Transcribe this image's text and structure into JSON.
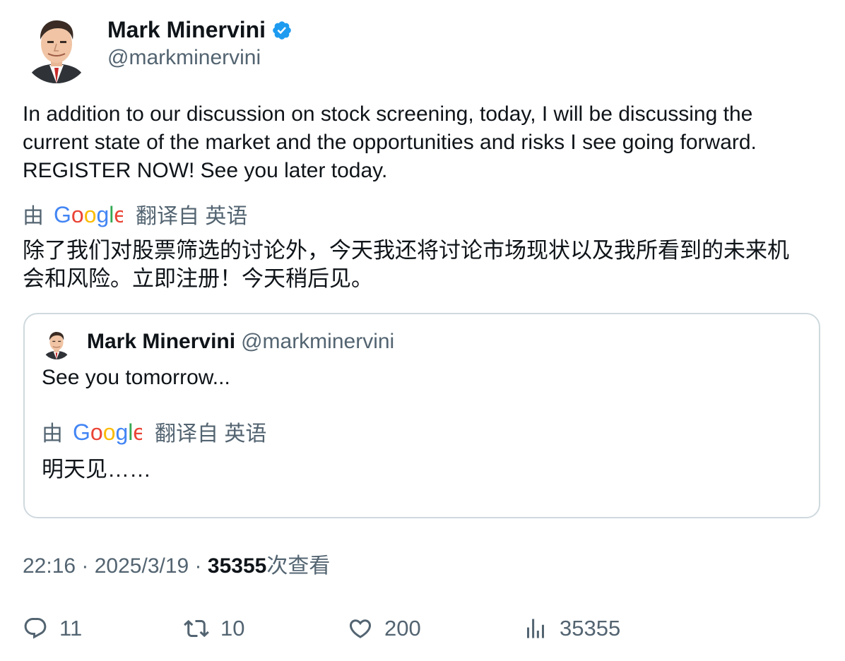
{
  "tweet": {
    "author": {
      "name": "Mark Minervini",
      "handle": "@markminervini",
      "verified": true,
      "avatar": "avatar-illustration"
    },
    "text_lines": [
      "In addition to our discussion on stock screening, today, I will be discussing the",
      "current state of the market and the opportunities and risks I see going forward.",
      "REGISTER NOW!  See you later today."
    ],
    "translation": {
      "by": "由",
      "provider": "Google",
      "from_label": "翻译自 英语",
      "text_lines": [
        "除了我们对股票筛选的讨论外，今天我还将讨论市场现状以及我所看到的未来机",
        "会和风险。立即注册！今天稍后见。"
      ]
    },
    "quoted": {
      "name": "Mark Minervini",
      "handle": "@markminervini",
      "text": "See you tomorrow...",
      "translation": {
        "by": "由",
        "provider": "Google",
        "from_label": "翻译自 英语",
        "text": "明天见……"
      }
    },
    "meta": {
      "time": "22:16",
      "sep1": " · ",
      "date": "2025/3/19",
      "sep2": " · ",
      "views_count": "35355",
      "views_label": "次查看"
    },
    "actions": {
      "replies": "11",
      "retweets": "10",
      "likes": "200",
      "views": "35355"
    },
    "colors": {
      "text": "#0f1419",
      "secondary": "#536471",
      "verified": "#1d9bf0",
      "border": "#cfd9de"
    }
  }
}
